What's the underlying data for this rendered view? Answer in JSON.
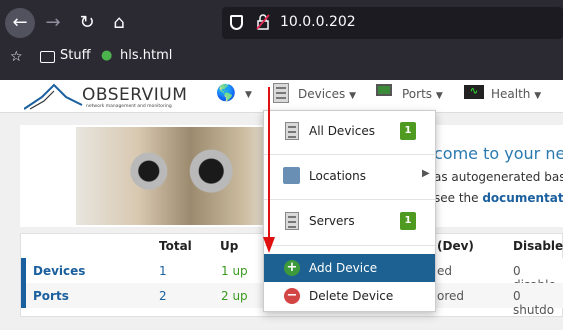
{
  "browser": {
    "url": "10.0.0.202",
    "bookmarks": [
      {
        "label": "Stuff",
        "icon": "folder-icon"
      },
      {
        "label": "hls.html",
        "icon": "frog-icon"
      }
    ]
  },
  "header": {
    "logo_text": "OBSERVIUM",
    "logo_subtitle": "network management and monitoring",
    "nav": {
      "devices": "Devices",
      "ports": "Ports",
      "health": "Health"
    }
  },
  "hero": {
    "title": "come to your ne",
    "line1": "as autogenerated base",
    "line2_prefix": "see the ",
    "line2_link": "documentation"
  },
  "stats": {
    "headers": {
      "total": "Total",
      "up": "Up",
      "dev": "(Dev)",
      "disabled": "Disabled"
    },
    "rows": [
      {
        "name": "Devices",
        "total": "1",
        "up": "1 up",
        "ignored": "ed",
        "disabled": "0 disable"
      },
      {
        "name": "Ports",
        "total": "2",
        "up": "2 up",
        "ignored": "ored",
        "disabled": "0 shutdo"
      }
    ]
  },
  "dropdown": {
    "items": [
      {
        "label": "All Devices",
        "badge": "1"
      },
      {
        "label": "Locations"
      },
      {
        "label": "Servers",
        "badge": "1"
      },
      {
        "label": "Add Device"
      },
      {
        "label": "Delete Device"
      }
    ]
  },
  "colors": {
    "accent": "#1c6191",
    "badge": "#4f9a20",
    "annotation": "#e01010"
  }
}
